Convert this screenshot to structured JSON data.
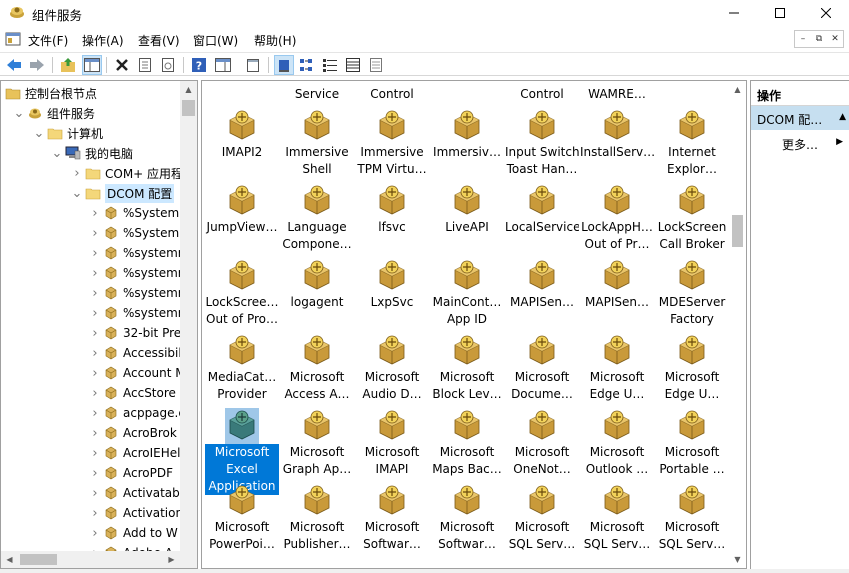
{
  "window": {
    "title": "组件服务",
    "title_icon": "component-services-icon"
  },
  "menu": {
    "items": [
      "文件(F)",
      "操作(A)",
      "查看(V)",
      "窗口(W)",
      "帮助(H)"
    ]
  },
  "mdi_controls": [
    "–",
    "⧉",
    "✕"
  ],
  "toolbar": {
    "buttons": [
      "back-icon",
      "forward-icon",
      "up-folder-icon",
      "show-hide-tree-icon",
      "delete-icon",
      "properties-icon",
      "export-list-icon",
      "help-icon",
      "show-hide-action-pane-icon",
      "new-window-icon",
      "large-icons-view-icon",
      "small-icons-view-icon",
      "list-view-icon",
      "details-view-icon",
      "more-view-icon"
    ]
  },
  "tree": {
    "items": [
      {
        "label": "控制台根节点",
        "level": 0,
        "expanded": true,
        "icon": "console-root-icon"
      },
      {
        "label": "组件服务",
        "level": 1,
        "expanded": true,
        "icon": "component-services-icon"
      },
      {
        "label": "计算机",
        "level": 2,
        "expanded": true,
        "icon": "folder-icon"
      },
      {
        "label": "我的电脑",
        "level": 3,
        "expanded": true,
        "icon": "computer-icon"
      },
      {
        "label": "COM+ 应用程",
        "level": 4,
        "expanded": false,
        "icon": "folder-icon"
      },
      {
        "label": "DCOM 配置",
        "level": 4,
        "expanded": true,
        "icon": "folder-icon",
        "selected": true
      },
      {
        "label": "%SystemR",
        "level": 5,
        "icon": "com-object-icon"
      },
      {
        "label": "%SystemR",
        "level": 5,
        "icon": "com-object-icon"
      },
      {
        "label": "%systemr",
        "level": 5,
        "icon": "com-object-icon"
      },
      {
        "label": "%systemr",
        "level": 5,
        "icon": "com-object-icon"
      },
      {
        "label": "%systemr",
        "level": 5,
        "icon": "com-object-icon"
      },
      {
        "label": "%systemr",
        "level": 5,
        "icon": "com-object-icon"
      },
      {
        "label": "32-bit Pre",
        "level": 5,
        "icon": "com-object-icon"
      },
      {
        "label": "Accessibil",
        "level": 5,
        "icon": "com-object-icon"
      },
      {
        "label": "Account M",
        "level": 5,
        "icon": "com-object-icon"
      },
      {
        "label": "AccStore C",
        "level": 5,
        "icon": "com-object-icon"
      },
      {
        "label": "acppage.c",
        "level": 5,
        "icon": "com-object-icon"
      },
      {
        "label": "AcroBrok",
        "level": 5,
        "icon": "com-object-icon"
      },
      {
        "label": "AcroIEHel",
        "level": 5,
        "icon": "com-object-icon"
      },
      {
        "label": "AcroPDF",
        "level": 5,
        "icon": "com-object-icon"
      },
      {
        "label": "Activatabl",
        "level": 5,
        "icon": "com-object-icon"
      },
      {
        "label": "Activation",
        "level": 5,
        "icon": "com-object-icon"
      },
      {
        "label": "Add to W",
        "level": 5,
        "icon": "com-object-icon"
      },
      {
        "label": "Adobe A",
        "level": 5,
        "icon": "com-object-icon"
      }
    ]
  },
  "grid": {
    "top_partial_labels": [
      "",
      "Service",
      "Control",
      "",
      "Control",
      "WAMRE…",
      ""
    ],
    "rows": [
      [
        {
          "label": "IMAPI2"
        },
        {
          "label": "Immersive\nShell"
        },
        {
          "label": "Immersive\nTPM Virtu…"
        },
        {
          "label": "Immersiv…"
        },
        {
          "label": "Input Switch\nToast Han…"
        },
        {
          "label": "InstallServ…"
        },
        {
          "label": "Internet\nExplor…"
        }
      ],
      [
        {
          "label": "JumpView…"
        },
        {
          "label": "Language\nCompone…"
        },
        {
          "label": "lfsvc"
        },
        {
          "label": "LiveAPI"
        },
        {
          "label": "LocalService"
        },
        {
          "label": "LockAppH…\nOut of Pr…"
        },
        {
          "label": "LockScreen\nCall Broker"
        }
      ],
      [
        {
          "label": "LockScree…\nOut of Pro…"
        },
        {
          "label": "logagent"
        },
        {
          "label": "LxpSvc"
        },
        {
          "label": "MainCont…\nApp ID"
        },
        {
          "label": "MAPISen…"
        },
        {
          "label": "MAPISen…"
        },
        {
          "label": "MDEServer\nFactory"
        }
      ],
      [
        {
          "label": "MediaCat…\nProvider"
        },
        {
          "label": "Microsoft\nAccess A…"
        },
        {
          "label": "Microsoft\nAudio D…"
        },
        {
          "label": "Microsoft\nBlock Lev…"
        },
        {
          "label": "Microsoft\nDocume…"
        },
        {
          "label": "Microsoft\nEdge U…"
        },
        {
          "label": "Microsoft\nEdge U…"
        }
      ],
      [
        {
          "label": "Microsoft\nExcel\nApplication",
          "selected": true
        },
        {
          "label": "Microsoft\nGraph Ap…"
        },
        {
          "label": "Microsoft\nIMAPI"
        },
        {
          "label": "Microsoft\nMaps Bac…"
        },
        {
          "label": "Microsoft\nOneNot…"
        },
        {
          "label": "Microsoft\nOutlook …"
        },
        {
          "label": "Microsoft\nPortable …"
        }
      ],
      [
        {
          "label": "Microsoft\nPowerPoi…"
        },
        {
          "label": "Microsoft\nPublisher…"
        },
        {
          "label": "Microsoft\nSoftwar…"
        },
        {
          "label": "Microsoft\nSoftwar…"
        },
        {
          "label": "Microsoft\nSQL Serv…"
        },
        {
          "label": "Microsoft\nSQL Serv…"
        },
        {
          "label": "Microsoft\nSQL Serv…"
        }
      ]
    ]
  },
  "actions": {
    "header": "操作",
    "section": "DCOM 配…",
    "more": "更多…"
  },
  "colors": {
    "selection": "#0078d7",
    "section_bg": "#c6dff0",
    "tree_selection": "#cce8ff"
  }
}
